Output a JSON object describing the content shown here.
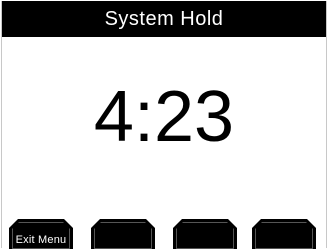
{
  "title_bar": {
    "title": "System Hold"
  },
  "main": {
    "time": "4:23"
  },
  "softkeys": [
    {
      "label": "Exit Menu"
    },
    {
      "label": ""
    },
    {
      "label": ""
    },
    {
      "label": ""
    }
  ]
}
